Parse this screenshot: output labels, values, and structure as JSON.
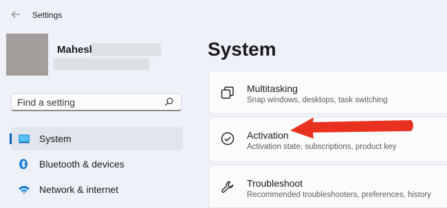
{
  "window": {
    "title": "Settings"
  },
  "profile": {
    "name": "Mahesh"
  },
  "search": {
    "placeholder": "Find a setting"
  },
  "sidebar": {
    "items": [
      {
        "label": "System",
        "selected": true
      },
      {
        "label": "Bluetooth & devices",
        "selected": false
      },
      {
        "label": "Network & internet",
        "selected": false
      }
    ]
  },
  "main": {
    "title": "System",
    "cards": [
      {
        "title": "Multitasking",
        "subtitle": "Snap windows, desktops, task switching",
        "icon": "multitasking-icon"
      },
      {
        "title": "Activation",
        "subtitle": "Activation state, subscriptions, product key",
        "icon": "check-circle-icon"
      },
      {
        "title": "Troubleshoot",
        "subtitle": "Recommended troubleshooters, preferences, history",
        "icon": "wrench-icon"
      }
    ]
  },
  "colors": {
    "accent": "#005fb8",
    "annotation_arrow": "#e8321f"
  }
}
